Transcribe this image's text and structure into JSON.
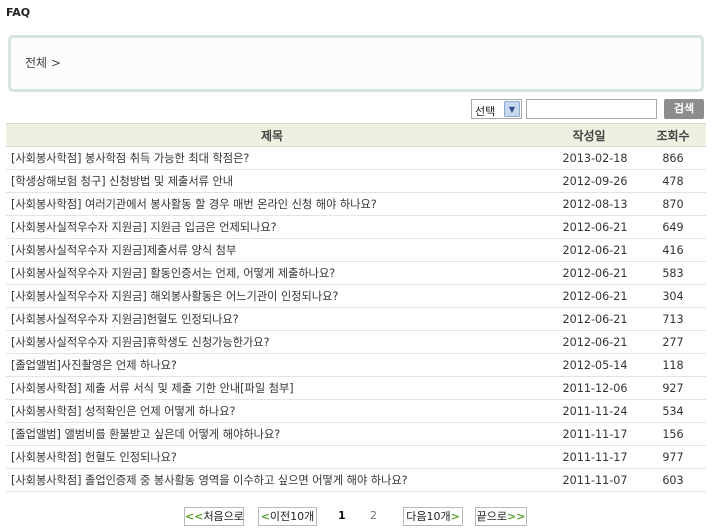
{
  "page": {
    "title": "FAQ"
  },
  "breadcrumb": {
    "text": "전체 >"
  },
  "search": {
    "select_value": "선택",
    "input_value": "",
    "button_label": "검색"
  },
  "table": {
    "headers": {
      "title": "제목",
      "date": "작성일",
      "views": "조회수"
    },
    "rows": [
      {
        "title": "[사회봉사학점] 봉사학점 취득 가능한 최대 학점은?",
        "date": "2013-02-18",
        "views": "866"
      },
      {
        "title": "[학생상해보험 청구] 신청방법 및 제출서류 안내",
        "date": "2012-09-26",
        "views": "478"
      },
      {
        "title": "[사회봉사학점] 여러기관에서 봉사활동 할 경우 매번 온라인 신청 해야 하나요?",
        "date": "2012-08-13",
        "views": "870"
      },
      {
        "title": "[사회봉사실적우수자 지원금] 지원금 입금은 언제되나요?",
        "date": "2012-06-21",
        "views": "649"
      },
      {
        "title": "[사회봉사실적우수자 지원금]제출서류 양식 첨부",
        "date": "2012-06-21",
        "views": "416"
      },
      {
        "title": "[사회봉사실적우수자 지원금] 활동인증서는 언제, 어떻게 제출하나요?",
        "date": "2012-06-21",
        "views": "583"
      },
      {
        "title": "[사회봉사실적우수자 지원금] 해외봉사활동은 어느기관이 인정되나요?",
        "date": "2012-06-21",
        "views": "304"
      },
      {
        "title": "[사회봉사실적우수자 지원금]헌혈도 인정되나요?",
        "date": "2012-06-21",
        "views": "713"
      },
      {
        "title": "[사회봉사실적우수자 지원금]휴학생도 신청가능한가요?",
        "date": "2012-06-21",
        "views": "277"
      },
      {
        "title": "[졸업앨범]사진촬영은 언제 하나요?",
        "date": "2012-05-14",
        "views": "118"
      },
      {
        "title": "[사회봉사학점] 제출 서류 서식 및 제출 기한 안내[파일 첨부]",
        "date": "2011-12-06",
        "views": "927"
      },
      {
        "title": "[사회봉사학점] 성적확인은 언제 어떻게 하나요?",
        "date": "2011-11-24",
        "views": "534"
      },
      {
        "title": "[졸업앨범] 앨범비를 환불받고 싶은데 어떻게 해야하나요?",
        "date": "2011-11-17",
        "views": "156"
      },
      {
        "title": "[사회봉사학점] 헌혈도 인정되나요?",
        "date": "2011-11-17",
        "views": "977"
      },
      {
        "title": "[사회봉사학점] 졸업인증제 중 봉사활동 영역을 이수하고 싶으면 어떻게 해야 하나요?",
        "date": "2011-11-07",
        "views": "603"
      }
    ]
  },
  "pagination": {
    "first_label": "처음으로",
    "prev_label": "이전10개",
    "pages": [
      {
        "label": "1",
        "current": true
      },
      {
        "label": "2",
        "current": false
      }
    ],
    "next_label": "다음10개",
    "last_label": "끝으로",
    "first_arrow": "<<",
    "prev_arrow": "<",
    "next_arrow": ">",
    "last_arrow": ">>"
  }
}
